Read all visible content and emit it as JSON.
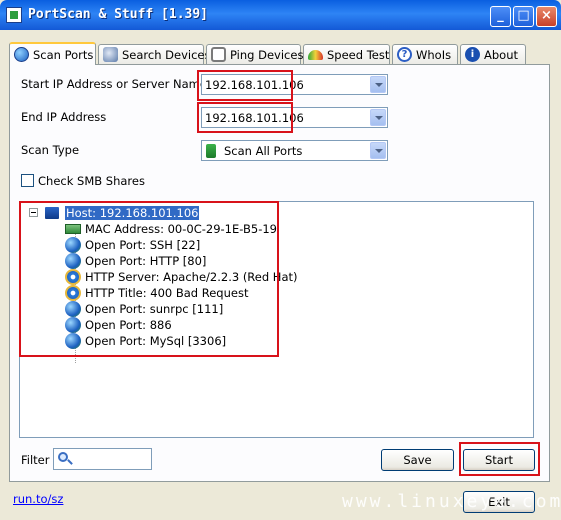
{
  "window": {
    "title": "PortScan & Stuff [1.39]",
    "minimize": "_",
    "maximize": "□",
    "close": "×"
  },
  "tabs": [
    {
      "label": "Scan Ports",
      "icon": "globe-icon",
      "active": true
    },
    {
      "label": "Search Devices",
      "icon": "network-icon",
      "active": false
    },
    {
      "label": "Ping Devices",
      "icon": "ping-icon",
      "active": false
    },
    {
      "label": "Speed Test",
      "icon": "gauge-icon",
      "active": false
    },
    {
      "label": "WhoIs",
      "icon": "help-icon",
      "active": false
    },
    {
      "label": "About",
      "icon": "info-icon",
      "active": false
    }
  ],
  "form": {
    "start_label": "Start IP Address or Server Name",
    "start_value": "192.168.101.106",
    "end_label": "End IP Address",
    "end_value": "192.168.101.106",
    "scan_type_label": "Scan Type",
    "scan_type_value": "Scan All Ports",
    "smb_label": "Check SMB Shares",
    "smb_checked": false
  },
  "tree": {
    "host": "Host: 192.168.101.106",
    "children": [
      {
        "text": "MAC Address: 00-0C-29-1E-B5-19",
        "icon": "network-card-icon"
      },
      {
        "text": "Open Port: SSH [22]",
        "icon": "globe-icon"
      },
      {
        "text": "Open Port: HTTP [80]",
        "icon": "globe-icon"
      },
      {
        "text": "HTTP Server: Apache/2.2.3 (Red Hat)",
        "icon": "ie-icon"
      },
      {
        "text": "HTTP Title: 400 Bad Request",
        "icon": "ie-icon"
      },
      {
        "text": "Open Port: sunrpc [111]",
        "icon": "globe-icon"
      },
      {
        "text": "Open Port: 886",
        "icon": "globe-icon"
      },
      {
        "text": "Open Port: MySql [3306]",
        "icon": "globe-icon"
      }
    ]
  },
  "bottom": {
    "filter_label": "Filter",
    "save_label": "Save",
    "start_label": "Start",
    "exit_label": "Exit",
    "link_text": "run.to/sz",
    "watermark": "www.linuxeye.com"
  },
  "colors": {
    "accent": "#316AC5",
    "highlight": "#D8121A",
    "link": "#0000FF"
  }
}
